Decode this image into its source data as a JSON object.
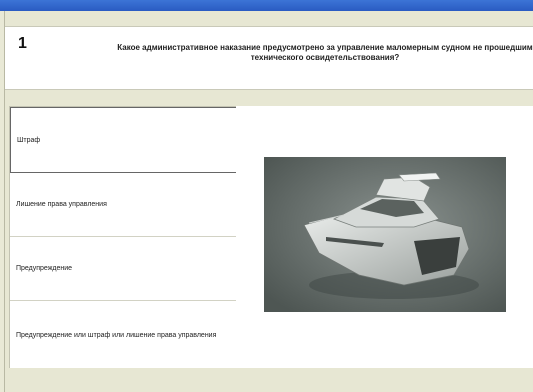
{
  "question": {
    "number": "1",
    "text_line1": "Какое административное наказание предусмотрено за управление маломерным судном не прошедшим",
    "text_line2": "технического освидетельствования?"
  },
  "answers": [
    {
      "label": "Штраф",
      "selected": true
    },
    {
      "label": "Лишение права управления",
      "selected": false
    },
    {
      "label": "Предупреждение",
      "selected": false
    },
    {
      "label": "Предупреждение или штраф или лишение права управления",
      "selected": false
    }
  ],
  "image": {
    "icon": "boat-photo"
  },
  "colors": {
    "titlebar": "#2f63cc",
    "background": "#e7e7d3",
    "panel": "#ffffff"
  }
}
